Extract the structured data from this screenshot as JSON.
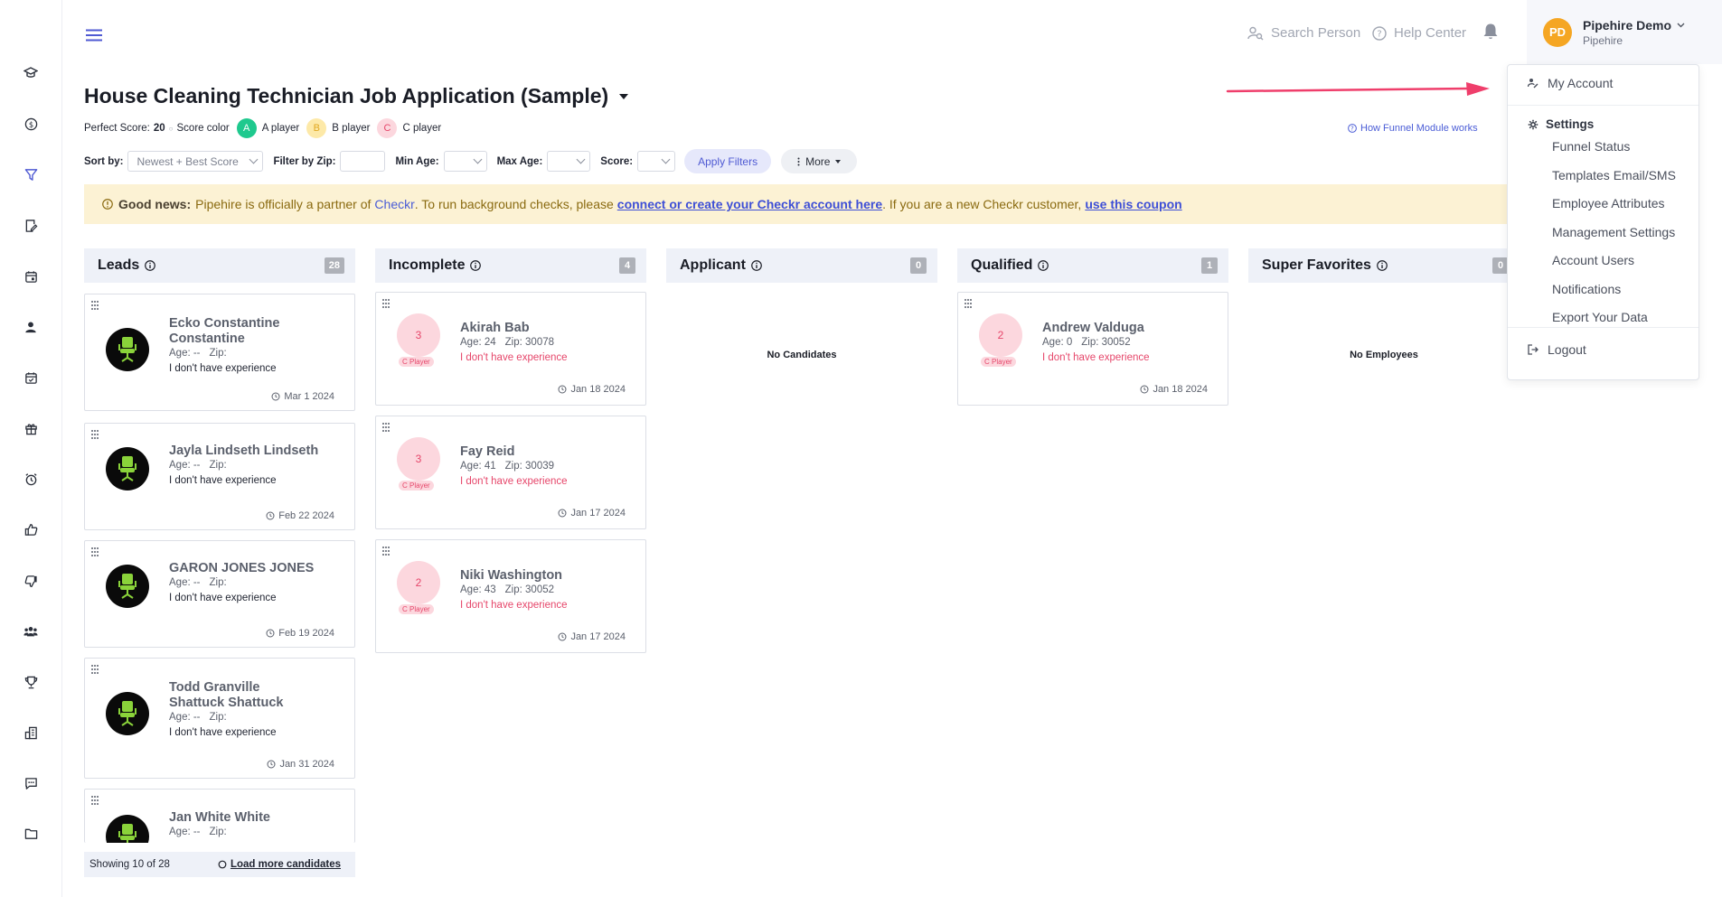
{
  "sidebar": {
    "items": [
      {
        "icon": "graduation-cap-icon"
      },
      {
        "icon": "dollar-circle-icon"
      },
      {
        "icon": "funnel-icon"
      },
      {
        "icon": "document-edit-icon"
      },
      {
        "icon": "calendar-icon"
      },
      {
        "icon": "person-icon"
      },
      {
        "icon": "calendar-check-icon"
      },
      {
        "icon": "gift-icon"
      },
      {
        "icon": "alarm-clock-icon"
      },
      {
        "icon": "thumbs-up-icon"
      },
      {
        "icon": "thumbs-down-icon"
      },
      {
        "icon": "group-icon"
      },
      {
        "icon": "trophy-icon"
      },
      {
        "icon": "building-icon"
      },
      {
        "icon": "chat-icon"
      },
      {
        "icon": "folder-icon"
      }
    ]
  },
  "topbar": {
    "search_label": "Search Person",
    "help_label": "Help Center",
    "user": {
      "initials": "PD",
      "name": "Pipehire Demo",
      "org": "Pipehire"
    }
  },
  "page": {
    "title": "House Cleaning Technician Job Application (Sample)",
    "perfect_score_label": "Perfect Score:",
    "perfect_score_value": "20",
    "score_color_label": "Score color",
    "grades": [
      {
        "letter": "A",
        "label": "A player",
        "bg": "#1fc98e",
        "fg": "#ffffff"
      },
      {
        "letter": "B",
        "label": "B player",
        "bg": "#fde9a8",
        "fg": "#e0a720"
      },
      {
        "letter": "C",
        "label": "C player",
        "bg": "#fcd7de",
        "fg": "#e6466a"
      }
    ],
    "how_link": "How Funnel Module works"
  },
  "filters": {
    "sort_label": "Sort by:",
    "sort_value": "Newest + Best Score",
    "zip_label": "Filter by Zip:",
    "min_age_label": "Min Age:",
    "max_age_label": "Max Age:",
    "score_label": "Score:",
    "apply_label": "Apply Filters",
    "more_label": "More"
  },
  "banner": {
    "lead": "Good news:",
    "text1": "Pipehire is officially a partner of",
    "checkr": "Checkr",
    "text2": ". To run background checks, please",
    "link1": "connect or create your Checkr account here",
    "text3": ". If you are a new Checkr customer,",
    "link2": "use this coupon"
  },
  "columns": [
    {
      "title": "Leads",
      "count": "28"
    },
    {
      "title": "Incomplete",
      "count": "4"
    },
    {
      "title": "Applicant",
      "count": "0",
      "empty": "No Candidates"
    },
    {
      "title": "Qualified",
      "count": "1"
    },
    {
      "title": "Super Favorites",
      "count": "0",
      "empty": "No Employees"
    }
  ],
  "leads": [
    {
      "name": "Ecko Constantine Constantine",
      "age": "Age: --",
      "zip": "Zip:",
      "exp": "I don't have experience",
      "date": "Mar 1 2024"
    },
    {
      "name": "Jayla Lindseth Lindseth",
      "age": "Age: --",
      "zip": "Zip:",
      "exp": "I don't have experience",
      "date": "Feb 22 2024"
    },
    {
      "name": "GARON JONES JONES",
      "age": "Age: --",
      "zip": "Zip:",
      "exp": "I don't have experience",
      "date": "Feb 19 2024"
    },
    {
      "name": "Todd Granville Shattuck Shattuck",
      "age": "Age: --",
      "zip": "Zip:",
      "exp": "I don't have experience",
      "date": "Jan 31 2024"
    },
    {
      "name": "Jan White White",
      "age": "Age: --",
      "zip": "Zip:"
    }
  ],
  "incomplete": [
    {
      "score": "3",
      "grade": "C Player",
      "name": "Akirah Bab",
      "age": "Age: 24",
      "zip": "Zip: 30078",
      "exp": "I don't have experience",
      "date": "Jan 18 2024"
    },
    {
      "score": "3",
      "grade": "C Player",
      "name": "Fay Reid",
      "age": "Age: 41",
      "zip": "Zip: 30039",
      "exp": "I don't have experience",
      "date": "Jan 17 2024"
    },
    {
      "score": "2",
      "grade": "C Player",
      "name": "Niki Washington",
      "age": "Age: 43",
      "zip": "Zip: 30052",
      "exp": "I don't have experience",
      "date": "Jan 17 2024"
    }
  ],
  "qualified": [
    {
      "score": "2",
      "grade": "C Player",
      "name": "Andrew Valduga",
      "age": "Age: 0",
      "zip": "Zip: 30052",
      "exp": "I don't have experience",
      "date": "Jan 18 2024"
    }
  ],
  "leads_footer": {
    "showing": "Showing 10 of 28",
    "load_more": "Load more candidates"
  },
  "dropdown": {
    "my_account": "My Account",
    "settings": "Settings",
    "settings_items": [
      "Funnel Status",
      "Templates Email/SMS",
      "Employee Attributes",
      "Management Settings",
      "Account Users",
      "Notifications",
      "Export Your Data"
    ],
    "logout": "Logout"
  },
  "colors": {
    "accent": "#4f5ad3",
    "arrow": "#ef3e6b",
    "banner_bg": "#fcf2d4"
  }
}
